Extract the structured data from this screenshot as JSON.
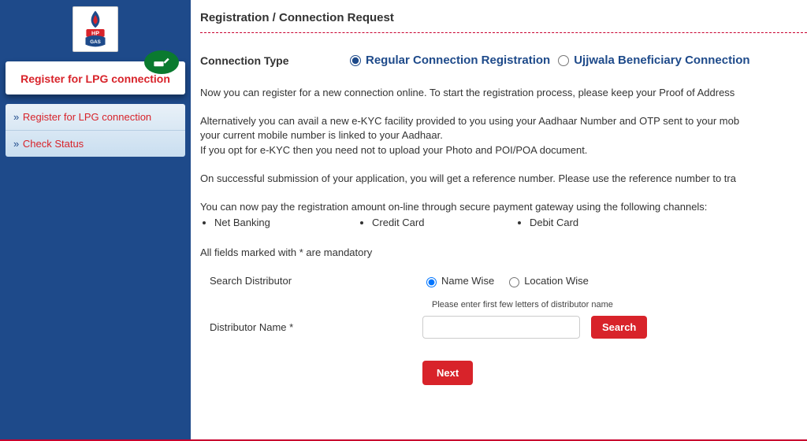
{
  "sidebar": {
    "header": "Register for LPG connection",
    "items": [
      {
        "label": "Register for LPG connection"
      },
      {
        "label": "Check Status"
      }
    ]
  },
  "page_title": "Registration / Connection Request",
  "connection_type": {
    "label": "Connection Type",
    "options": [
      {
        "label": "Regular Connection Registration",
        "selected": true
      },
      {
        "label": "Ujjwala Beneficiary Connection",
        "selected": false
      }
    ]
  },
  "info": {
    "p1": "Now you can register for a new connection online. To start the registration process, please keep your Proof of Address",
    "p2a": "Alternatively you can avail a new e-KYC facility provided to you using your Aadhaar Number and OTP sent to your mob",
    "p2b": "your current mobile number is linked to your Aadhaar.",
    "p2c": "If you opt for e-KYC then you need not to upload your Photo and POI/POA document.",
    "p3": "On successful submission of your application, you will get a reference number. Please use the reference number to tra",
    "p4": "You can now pay the registration amount on-line through secure payment gateway using the following channels:",
    "payment_channels": [
      "Net Banking",
      "Credit Card",
      "Debit Card"
    ],
    "mandatory_note": "All fields marked with * are mandatory"
  },
  "search": {
    "label": "Search Distributor",
    "options": [
      {
        "label": "Name Wise",
        "selected": true
      },
      {
        "label": "Location Wise",
        "selected": false
      }
    ],
    "hint": "Please enter first few letters of distributor name",
    "distributor_label": "Distributor Name *",
    "distributor_value": "",
    "search_button": "Search"
  },
  "next_button": "Next"
}
